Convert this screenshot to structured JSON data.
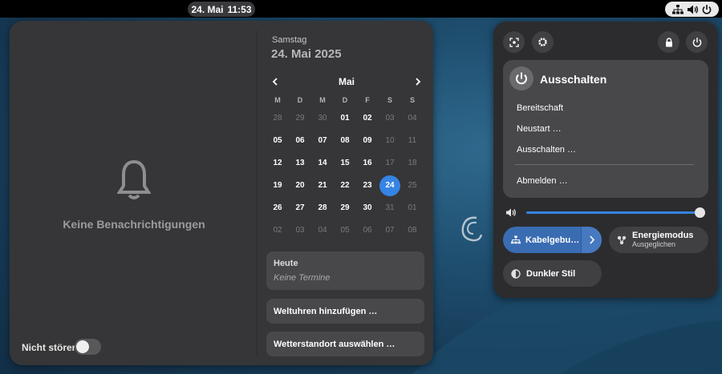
{
  "topbar": {
    "date": "24. Mai",
    "time": "11:53",
    "indicators": [
      "network-wired-icon",
      "volume-icon",
      "power-icon"
    ]
  },
  "notifications": {
    "empty_label": "Keine Benachrichtigungen",
    "dnd_label": "Nicht stören",
    "dnd_enabled": false
  },
  "calendar": {
    "weekday": "Samstag",
    "full_date": "24. Mai 2025",
    "month": "Mai",
    "day_headers": [
      "M",
      "D",
      "M",
      "D",
      "F",
      "S",
      "S"
    ],
    "weeks": [
      [
        {
          "d": "28",
          "dim": true
        },
        {
          "d": "29",
          "dim": true
        },
        {
          "d": "30",
          "dim": true
        },
        {
          "d": "01"
        },
        {
          "d": "02"
        },
        {
          "d": "03",
          "dim": true
        },
        {
          "d": "04",
          "dim": true
        }
      ],
      [
        {
          "d": "05"
        },
        {
          "d": "06"
        },
        {
          "d": "07"
        },
        {
          "d": "08"
        },
        {
          "d": "09"
        },
        {
          "d": "10",
          "dim": true
        },
        {
          "d": "11",
          "dim": true
        }
      ],
      [
        {
          "d": "12"
        },
        {
          "d": "13"
        },
        {
          "d": "14"
        },
        {
          "d": "15"
        },
        {
          "d": "16"
        },
        {
          "d": "17",
          "dim": true
        },
        {
          "d": "18",
          "dim": true
        }
      ],
      [
        {
          "d": "19"
        },
        {
          "d": "20"
        },
        {
          "d": "21"
        },
        {
          "d": "22"
        },
        {
          "d": "23"
        },
        {
          "d": "24",
          "today": true
        },
        {
          "d": "25",
          "dim": true
        }
      ],
      [
        {
          "d": "26"
        },
        {
          "d": "27"
        },
        {
          "d": "28"
        },
        {
          "d": "29"
        },
        {
          "d": "30"
        },
        {
          "d": "31",
          "dim": true
        },
        {
          "d": "01",
          "dim": true
        }
      ],
      [
        {
          "d": "02",
          "dim": true
        },
        {
          "d": "03",
          "dim": true
        },
        {
          "d": "04",
          "dim": true
        },
        {
          "d": "05",
          "dim": true
        },
        {
          "d": "06",
          "dim": true
        },
        {
          "d": "07",
          "dim": true
        },
        {
          "d": "08",
          "dim": true
        }
      ]
    ],
    "today_title": "Heute",
    "today_events": "Keine Termine",
    "world_clocks_label": "Weltuhren hinzufügen …",
    "weather_label": "Wetterstandort auswählen …"
  },
  "quick_settings": {
    "power_title": "Ausschalten",
    "power_items": [
      "Bereitschaft",
      "Neustart …",
      "Ausschalten …"
    ],
    "logout_label": "Abmelden …",
    "volume_level": 1.0,
    "network_label": "Kabelgebu…",
    "energy_label": "Energiemodus",
    "energy_sub": "Ausgeglichen",
    "dark_style_label": "Dunkler Stil",
    "accent_color": "#3584e4"
  }
}
